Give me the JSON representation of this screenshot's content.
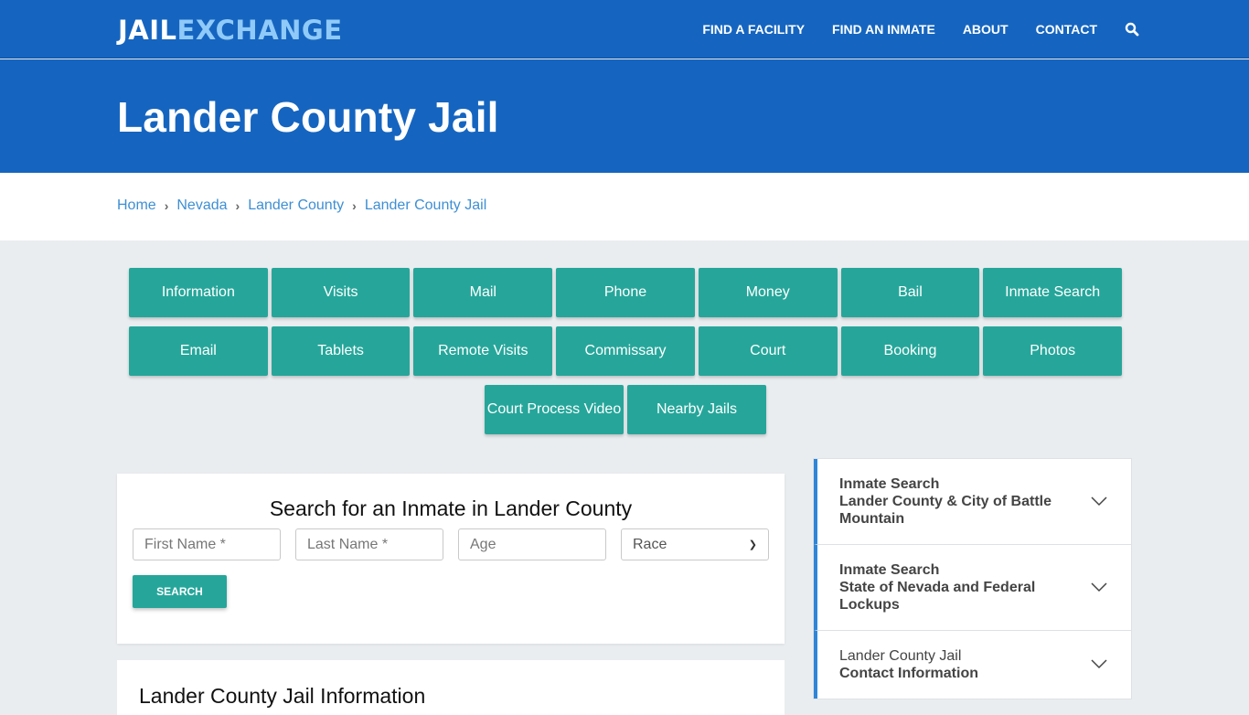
{
  "header": {
    "logo_part1": "JAIL",
    "logo_part2": "EXCHANGE",
    "nav": [
      "FIND A FACILITY",
      "FIND AN INMATE",
      "ABOUT",
      "CONTACT"
    ],
    "search_icon": "search-icon"
  },
  "hero": {
    "title": "Lander County Jail"
  },
  "breadcrumb": [
    "Home",
    "Nevada",
    "Lander County",
    "Lander County Jail"
  ],
  "topic_buttons": {
    "row1": [
      "Information",
      "Visits",
      "Mail",
      "Phone",
      "Money",
      "Bail",
      "Inmate Search"
    ],
    "row2": [
      "Email",
      "Tablets",
      "Remote Visits",
      "Commissary",
      "Court",
      "Booking",
      "Photos"
    ],
    "row3": [
      "Court Process Video",
      "Nearby Jails"
    ]
  },
  "search": {
    "title": "Search for an Inmate in Lander County",
    "first_name_placeholder": "First Name *",
    "last_name_placeholder": "Last Name *",
    "age_placeholder": "Age",
    "race_selected": "Race",
    "button": "SEARCH"
  },
  "info": {
    "title": "Lander County Jail Information"
  },
  "sidebar": [
    {
      "line1": "Inmate Search",
      "line2": "Lander County & City of Battle Mountain"
    },
    {
      "line1": "Inmate Search",
      "line2": "State of Nevada and Federal Lockups"
    },
    {
      "line1": "Lander County Jail",
      "line2": "Contact Information"
    }
  ],
  "colors": {
    "brand_blue": "#1565c0",
    "logo_accent": "#90caf9",
    "teal": "#26a69a",
    "link": "#3d8fd4"
  }
}
